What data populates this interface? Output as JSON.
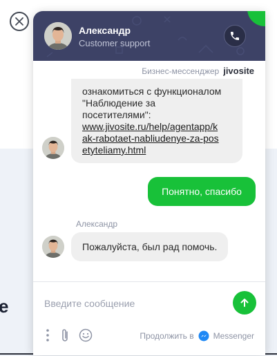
{
  "page": {
    "edge_text": "e"
  },
  "header": {
    "agent_name": "Александр",
    "agent_role": "Customer support"
  },
  "branding": {
    "label": "Бизнес-мессенджер",
    "logo_text": "jivosite"
  },
  "messages": [
    {
      "from": "agent",
      "text_lines": [
        "ознакомиться с функционалом",
        "\"Наблюдение за",
        "посетителями\":"
      ],
      "link_lines": [
        "www.jivosite.ru/help/agentapp/k",
        "ak-rabotaet-nabliudenye-za-pos",
        "etyteliamy.html"
      ]
    },
    {
      "from": "visitor",
      "text": "Понятно, спасибо"
    },
    {
      "from": "agent",
      "sender": "Александр",
      "text": "Пожалуйста, был рад помочь."
    }
  ],
  "composer": {
    "placeholder": "Введите сообщение",
    "continue_label": "Продолжить в",
    "messenger_label": "Messenger"
  },
  "icons": {
    "close": "close-icon",
    "call": "phone-icon",
    "send": "arrow-up-icon",
    "menu": "more-vertical-icon",
    "attach": "paperclip-icon",
    "emoji": "smiley-icon",
    "messenger": "messenger-icon"
  },
  "colors": {
    "header_bg": "#3d4266",
    "accent_green": "#18c139",
    "agent_bubble": "#efefef",
    "muted_text": "#8d93a4"
  }
}
